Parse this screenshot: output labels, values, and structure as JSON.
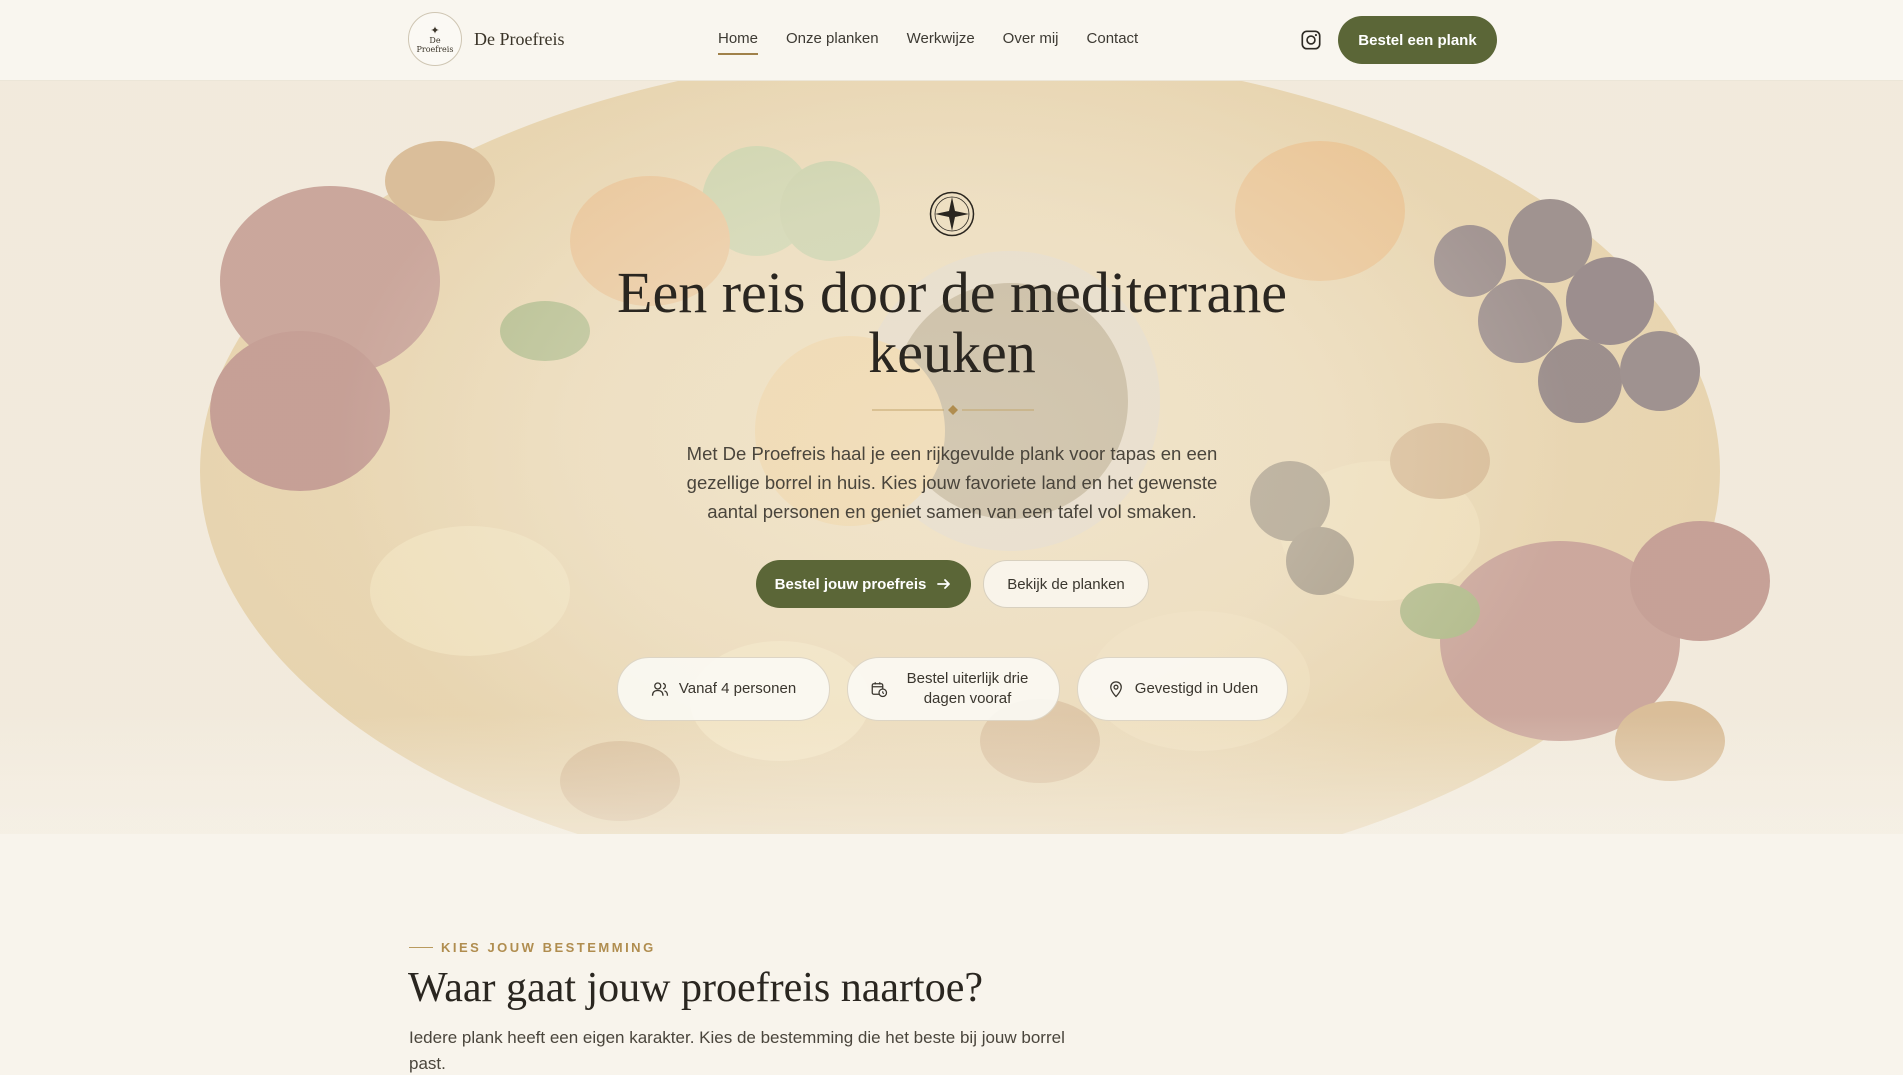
{
  "brand": {
    "name": "De Proefreis",
    "logo_line1": "De",
    "logo_line2": "Proefreis"
  },
  "nav": [
    {
      "label": "Home"
    },
    {
      "label": "Onze planken"
    },
    {
      "label": "Werkwijze"
    },
    {
      "label": "Over mij"
    },
    {
      "label": "Contact"
    }
  ],
  "header": {
    "cta_label": "Bestel een plank",
    "instagram_icon": "instagram-icon"
  },
  "hero": {
    "title": "Een reis door de mediterrane keuken",
    "text": "Met De Proefreis haal je een rijkgevulde plank voor tapas en een gezellige borrel in huis. Kies jouw favoriete land en het gewenste aantal personen en geniet samen van een tafel vol smaken.",
    "primary_label": "Bestel jouw proefreis",
    "secondary_label": "Bekijk de planken",
    "features": [
      {
        "icon": "users-icon",
        "label": "Vanaf 4 personen"
      },
      {
        "icon": "calendar-clock-icon",
        "label": "Bestel uiterlijk drie dagen vooraf"
      },
      {
        "icon": "map-pin-icon",
        "label": "Gevestigd in Uden"
      }
    ]
  },
  "section": {
    "eyebrow": "KIES JOUW BESTEMMING",
    "title": "Waar gaat jouw proefreis naartoe?",
    "text": "Iedere plank heeft een eigen karakter. Kies de bestemming die het beste bij jouw borrel past."
  },
  "colors": {
    "accent": "#5b6637",
    "gold": "#b08d4f",
    "background": "#f8f4ec"
  }
}
